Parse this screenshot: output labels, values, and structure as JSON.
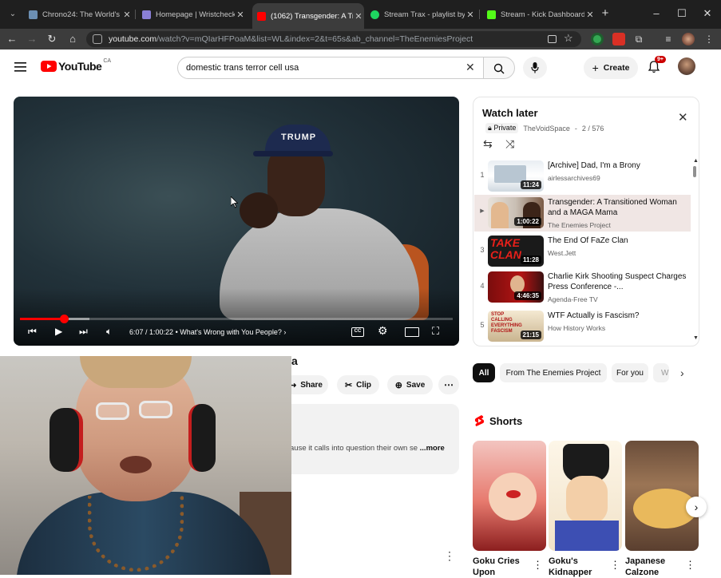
{
  "browser": {
    "tabs": [
      {
        "title": "Chrono24: The World's Le",
        "icon": "chrono24-favicon",
        "color": "#6c8fb3"
      },
      {
        "title": "Homepage | Wristcheck",
        "icon": "wristcheck-favicon",
        "color": "#8a7fd6"
      },
      {
        "title": "(1062) Transgender: A Tr",
        "icon": "youtube-favicon",
        "color": "#ff0000",
        "active": true
      },
      {
        "title": "Stream Trax - playlist by",
        "icon": "spotify-favicon",
        "color": "#1ed760"
      },
      {
        "title": "Stream - Kick Dashboard",
        "icon": "kick-favicon",
        "color": "#53fc18"
      }
    ],
    "new_tab": "+",
    "url_host": "youtube.com",
    "url_path": "/watch?v=mQIarHFPoaM&list=WL&index=2&t=65s&ab_channel=TheEnemiesProject"
  },
  "youtube": {
    "logo_text": "YouTube",
    "logo_region": "CA",
    "search_query": "domestic trans terror cell usa",
    "create_label": "Create",
    "notifications_badge": "9+"
  },
  "player": {
    "time": "6:07 / 1:00:22",
    "chapter": "What's Wrong with You People?",
    "progress_fraction": 0.101,
    "buffered_fraction": 0.16,
    "cap_text": "TRUMP"
  },
  "video_below": {
    "title_fragment": "a",
    "actions": [
      {
        "label": "Share",
        "icon": "share-icon"
      },
      {
        "label": "Clip",
        "icon": "scissors-icon"
      },
      {
        "label": "Save",
        "icon": "save-icon"
      }
    ],
    "description_snippet": "ause it calls into question their own se",
    "more_label": "...more"
  },
  "playlist": {
    "title": "Watch later",
    "privacy": "Private",
    "owner": "TheVoidSpace",
    "position": "2 / 576",
    "items": [
      {
        "index": "1",
        "title": "[Archive] Dad, I'm a Brony",
        "channel": "airlessarchives69",
        "duration": "11:24",
        "active": false
      },
      {
        "index": "▶",
        "title": "Transgender: A Transitioned Woman and a MAGA Mama",
        "channel": "The Enemies Project",
        "duration": "1:00:22",
        "active": true
      },
      {
        "index": "3",
        "title": "The End Of FaZe Clan",
        "channel": "West.Jett",
        "duration": "11:28",
        "active": false
      },
      {
        "index": "4",
        "title": "Charlie Kirk Shooting Suspect Charges Press Conference -...",
        "channel": "Agenda-Free TV",
        "duration": "4:46:35",
        "active": false
      },
      {
        "index": "5",
        "title": "WTF Actually is Fascism?",
        "channel": "How History Works",
        "duration": "21:15",
        "active": false
      }
    ]
  },
  "chips": [
    {
      "label": "All",
      "selected": true
    },
    {
      "label": "From The Enemies Project",
      "selected": false
    },
    {
      "label": "For you",
      "selected": false
    },
    {
      "label": "W",
      "selected": false
    }
  ],
  "shorts": {
    "heading": "Shorts",
    "items": [
      {
        "title": "Goku Cries Upon"
      },
      {
        "title": "Goku's Kidnapper"
      },
      {
        "title": "Japanese Calzone"
      }
    ]
  },
  "thumb_text": {
    "faze": "TAKE CLAN",
    "fascism": "STOP CALLING EVERYTHING FASCISM"
  }
}
